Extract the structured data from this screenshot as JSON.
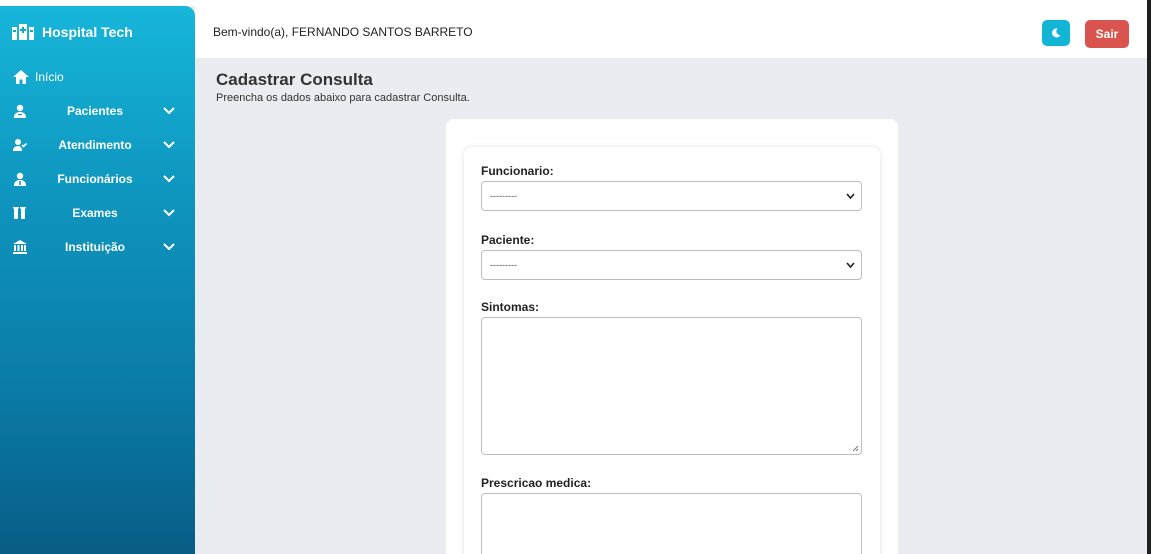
{
  "app": {
    "brand": "Hospital Tech"
  },
  "sidebar": {
    "home_label": "Início",
    "items": [
      {
        "label": "Pacientes",
        "icon": "patient-icon"
      },
      {
        "label": "Atendimento",
        "icon": "user-check-icon"
      },
      {
        "label": "Funcionários",
        "icon": "employee-icon"
      },
      {
        "label": "Exames",
        "icon": "flask-icon"
      },
      {
        "label": "Instituição",
        "icon": "bank-icon"
      }
    ]
  },
  "header": {
    "welcome": "Bem-vindo(a), FERNANDO SANTOS BARRETO",
    "theme_icon": "moon-icon",
    "logout_label": "Sair"
  },
  "page": {
    "title": "Cadastrar Consulta",
    "subtitle": "Preencha os dados abaixo para cadastrar Consulta."
  },
  "form": {
    "funcionario_label": "Funcionario:",
    "funcionario_value": "---------",
    "paciente_label": "Paciente:",
    "paciente_value": "---------",
    "sintomas_label": "Sintomas:",
    "prescricao_label": "Prescricao medica:"
  },
  "colors": {
    "sidebar_top": "#17b6da",
    "sidebar_bottom": "#085d86",
    "accent": "#12b5d6",
    "danger": "#d9534f"
  }
}
